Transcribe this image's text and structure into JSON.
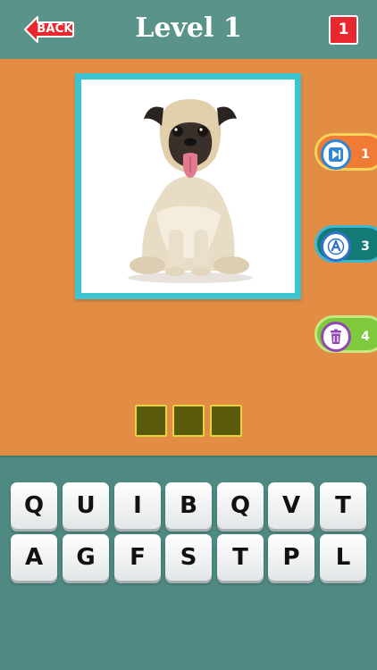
{
  "header": {
    "back_label": "BACK",
    "title": "Level 1",
    "coins": "1"
  },
  "puzzle": {
    "image_subject": "pug-dog",
    "answer_slots": [
      "",
      "",
      ""
    ]
  },
  "hints": [
    {
      "name": "skip",
      "icon": "skip-forward-icon",
      "count": "1"
    },
    {
      "name": "reveal-letter",
      "icon": "letter-a-icon",
      "count": "3"
    },
    {
      "name": "remove-letters",
      "icon": "trash-can-icon",
      "count": "4"
    }
  ],
  "keyboard": {
    "row1": [
      "Q",
      "U",
      "I",
      "B",
      "Q",
      "V",
      "T"
    ],
    "row2": [
      "A",
      "G",
      "F",
      "S",
      "T",
      "P",
      "L"
    ]
  },
  "colors": {
    "header_bg": "#5a938a",
    "play_bg": "#e38c44",
    "frame": "#3cc4d1",
    "slot_fill": "#5a5a0b",
    "slot_border": "#e8d43a",
    "back_button": "#e8282e"
  }
}
